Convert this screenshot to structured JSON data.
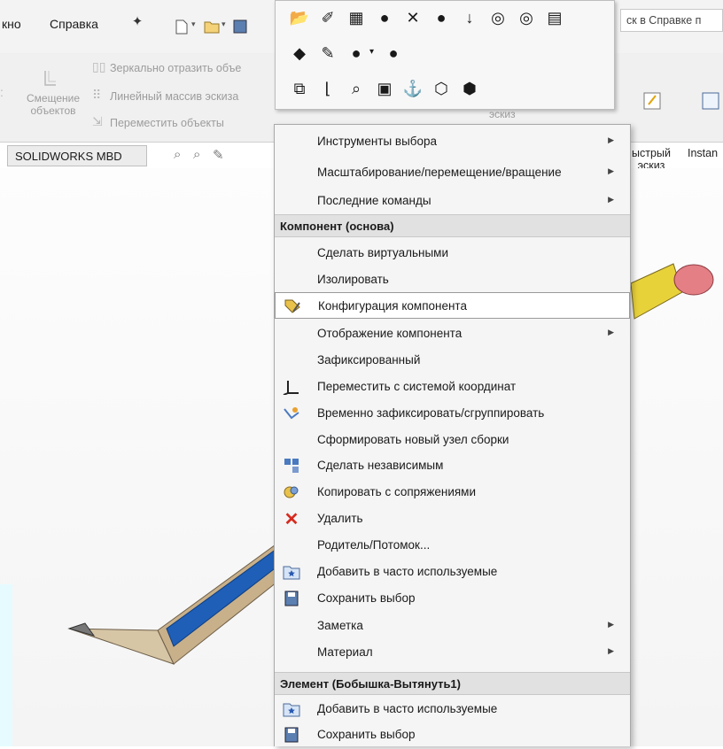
{
  "menubar": {
    "window_partial": "кно",
    "help": "Справка"
  },
  "search": {
    "placeholder": "ск в Справке п"
  },
  "ribbon": {
    "offset_label": "Смещение\nобъектов",
    "mirror": "Зеркально отразить объе",
    "linear_pattern": "Линейный массив эскиза",
    "move": "Переместить объекты",
    "sketch_partial": "эскиз",
    "quick_sketch": "ыстрый\nэскиз",
    "instant": "Instan"
  },
  "tabs": {
    "mbd": "SOLIDWORKS MBD"
  },
  "context_menu": {
    "items_top": [
      {
        "label": "Инструменты выбора",
        "arrow": true
      },
      {
        "label": "Масштабирование/перемещение/вращение",
        "arrow": true
      },
      {
        "label": "Последние команды",
        "arrow": true
      }
    ],
    "section1_header": "Компонент (основа)",
    "items_section1": [
      {
        "label": "Сделать виртуальными",
        "icon": "",
        "arrow": false
      },
      {
        "label": "Изолировать",
        "icon": "",
        "arrow": false
      },
      {
        "label": "Конфигурация компонента",
        "icon": "configuration-icon",
        "arrow": false,
        "selected": true
      },
      {
        "label": "Отображение компонента",
        "icon": "",
        "arrow": true
      },
      {
        "label": "Зафиксированный",
        "icon": "",
        "arrow": false
      },
      {
        "label": "Переместить с системой координат",
        "icon": "move-triad-icon",
        "arrow": false
      },
      {
        "label": "Временно зафиксировать/сгруппировать",
        "icon": "fix-group-icon",
        "arrow": false
      },
      {
        "label": "Сформировать новый узел сборки",
        "icon": "",
        "arrow": false
      },
      {
        "label": "Сделать независимым",
        "icon": "make-independent-icon",
        "arrow": false
      },
      {
        "label": "Копировать с сопряжениями",
        "icon": "copy-mates-icon",
        "arrow": false
      },
      {
        "label": "Удалить",
        "icon": "delete-icon",
        "arrow": false
      },
      {
        "label": "Родитель/Потомок...",
        "icon": "",
        "arrow": false
      },
      {
        "label": "Добавить в часто используемые",
        "icon": "favorites-icon",
        "arrow": false
      },
      {
        "label": "Сохранить выбор",
        "icon": "save-selection-icon",
        "arrow": false
      },
      {
        "label": "Заметка",
        "icon": "",
        "arrow": true
      },
      {
        "label": "Материал",
        "icon": "",
        "arrow": true
      }
    ],
    "section2_header": "Элемент (Бобышка-Вытянуть1)",
    "items_section2": [
      {
        "label": "Добавить в часто используемые",
        "icon": "favorites-icon"
      },
      {
        "label": "Сохранить выбор",
        "icon": "save-selection-icon"
      }
    ]
  },
  "colors": {
    "pencil_body": "#c8b08a",
    "pencil_stripe": "#1f5fb8",
    "eraser": "#e47f86",
    "ferrule": "#e8d23a",
    "delete_red": "#d62a1e"
  }
}
